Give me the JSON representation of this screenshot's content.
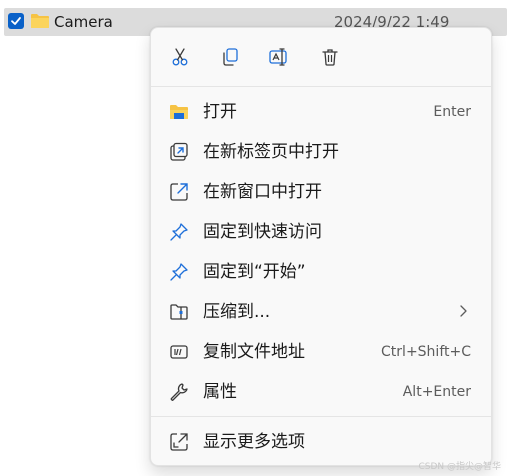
{
  "file": {
    "name": "Camera",
    "date": "2024/9/22 1:49",
    "selected": true
  },
  "quick_actions": [
    {
      "icon": "cut-icon"
    },
    {
      "icon": "copy-icon"
    },
    {
      "icon": "rename-icon"
    },
    {
      "icon": "delete-icon"
    }
  ],
  "menu": {
    "items": [
      {
        "icon": "folder-icon",
        "label": "打开",
        "shortcut": "Enter"
      },
      {
        "icon": "open-new-tab-icon",
        "label": "在新标签页中打开",
        "shortcut": ""
      },
      {
        "icon": "open-new-window-icon",
        "label": "在新窗口中打开",
        "shortcut": ""
      },
      {
        "icon": "pin-icon",
        "label": "固定到快速访问",
        "shortcut": ""
      },
      {
        "icon": "pin-icon",
        "label": "固定到“开始”",
        "shortcut": ""
      },
      {
        "icon": "zip-icon",
        "label": "压缩到...",
        "shortcut": ""
      },
      {
        "icon": "copy-path-icon",
        "label": "复制文件地址",
        "shortcut": "Ctrl+Shift+C"
      },
      {
        "icon": "wrench-icon",
        "label": "属性",
        "shortcut": "Alt+Enter"
      }
    ],
    "more": {
      "icon": "show-more-icon",
      "label": "显示更多选项"
    }
  },
  "watermark": "CSDN @指尖@智华",
  "colors": {
    "accent": "#0a61c8",
    "pin": "#1e6fd9",
    "folder": "#f6c344",
    "menu_bg": "#f9f9f9",
    "selection": "#dcdcdc"
  }
}
